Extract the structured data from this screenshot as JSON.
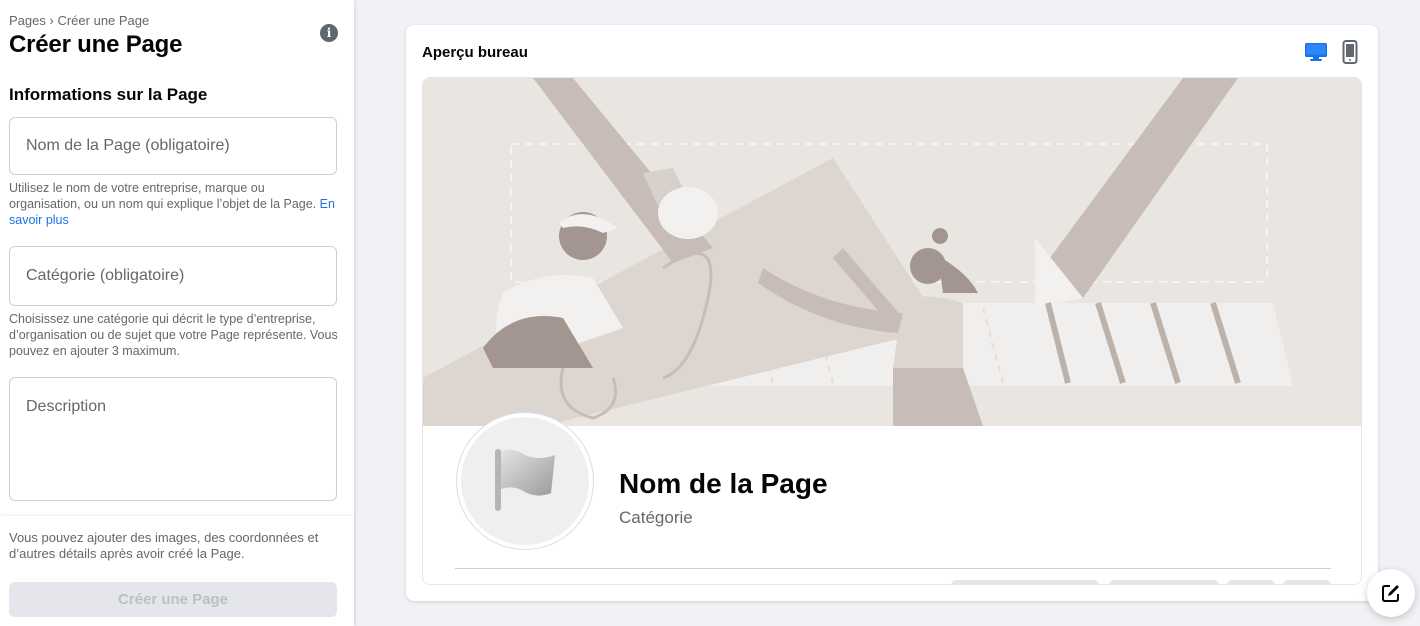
{
  "breadcrumb": {
    "root": "Pages",
    "separator": "›",
    "current": "Créer une Page"
  },
  "header": {
    "title": "Créer une Page",
    "info_icon": "info-icon"
  },
  "form": {
    "section_title": "Informations sur la Page",
    "name_field": {
      "placeholder": "Nom de la Page (obligatoire)",
      "value": ""
    },
    "name_help": "Utilisez le nom de votre entreprise, marque ou organisation, ou un nom qui explique l’objet de la Page.",
    "name_help_link": "En savoir plus",
    "category_field": {
      "placeholder": "Catégorie (obligatoire)",
      "value": ""
    },
    "category_help": "Choisissez une catégorie qui décrit le type d’entreprise, d’organisation ou de sujet que votre Page représente. Vous pouvez en ajouter 3 maximum.",
    "description_field": {
      "placeholder": "Description",
      "value": ""
    }
  },
  "footer": {
    "note": "Vous pouvez ajouter des images, des coordonnées et d’autres détails après avoir créé la Page.",
    "create_button": "Créer une Page"
  },
  "preview": {
    "title": "Aperçu bureau",
    "desktop_icon": "desktop-monitor-icon",
    "mobile_icon": "mobile-phone-icon",
    "page_name": "Nom de la Page",
    "page_category": "Catégorie",
    "avatar_icon": "flag-icon"
  },
  "fab": {
    "icon": "compose-icon"
  },
  "colors": {
    "accent": "#1b74e4",
    "disabled_bg": "#e4e6eb",
    "disabled_text": "#bcc0c4",
    "cover_bg": "#e9e5e1"
  }
}
